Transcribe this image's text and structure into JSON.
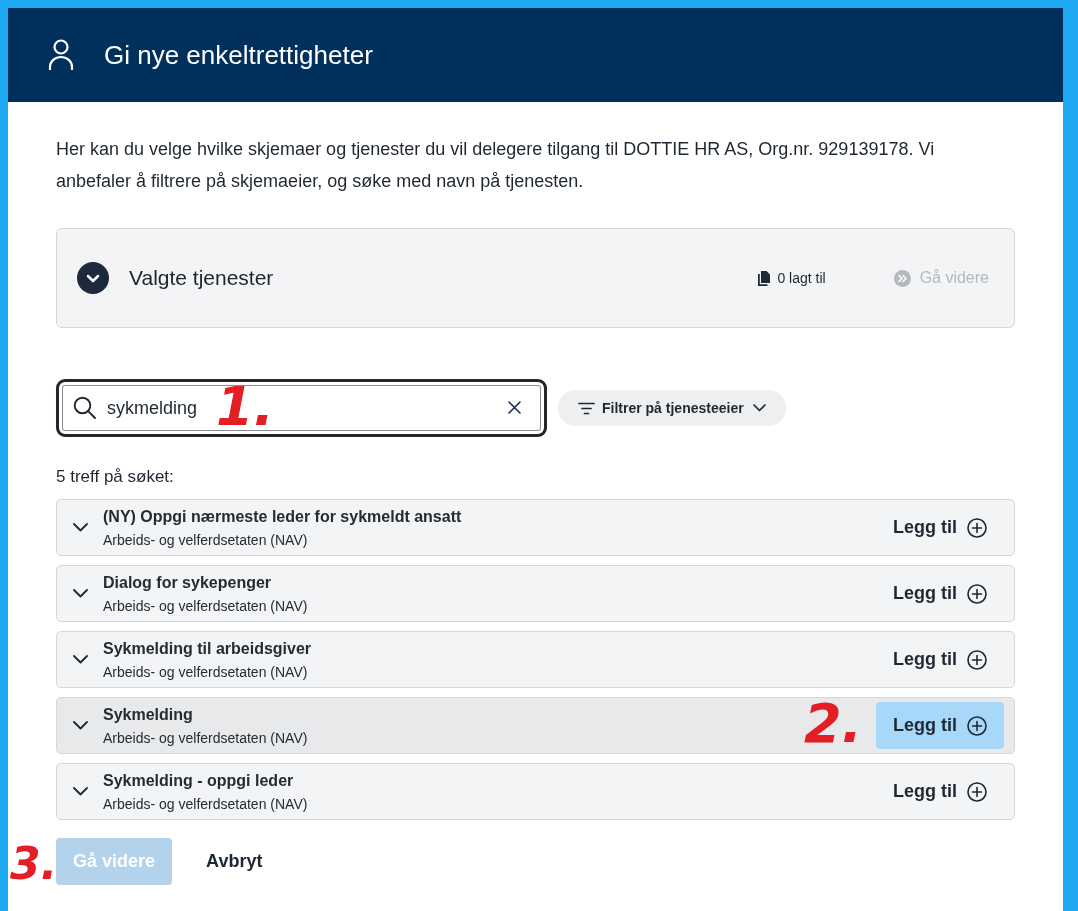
{
  "header": {
    "title": "Gi nye enkeltrettigheter"
  },
  "intro": "Her kan du velge hvilke skjemaer og tjenester du vil delegere tilgang til DOTTIE HR AS, Org.nr. 929139178. Vi anbefaler å filtrere på skjemaeier, og søke med navn på tjenesten.",
  "selected_panel": {
    "title": "Valgte tjenester",
    "expanded": false,
    "count": "0 lagt til",
    "next_button": {
      "label": "Gå videre",
      "disabled": true
    }
  },
  "search": {
    "value": "sykmelding",
    "annotation": "1."
  },
  "filter": {
    "label": "Filtrer på tjenesteeier"
  },
  "result_count": "5 treff på søket:",
  "results": [
    {
      "title": "(NY) Oppgi nærmeste leder for sykmeldt ansatt",
      "owner": "Arbeids- og velferdsetaten (NAV)",
      "add_label": "Legg til",
      "highlighted": false
    },
    {
      "title": "Dialog for sykepenger",
      "owner": "Arbeids- og velferdsetaten (NAV)",
      "add_label": "Legg til",
      "highlighted": false
    },
    {
      "title": "Sykmelding til arbeidsgiver",
      "owner": "Arbeids- og velferdsetaten (NAV)",
      "add_label": "Legg til",
      "highlighted": false
    },
    {
      "title": "Sykmelding",
      "owner": "Arbeids- og velferdsetaten (NAV)",
      "add_label": "Legg til",
      "highlighted": true,
      "annotation": "2."
    },
    {
      "title": "Sykmelding - oppgi leder",
      "owner": "Arbeids- og velferdsetaten (NAV)",
      "add_label": "Legg til",
      "highlighted": false
    }
  ],
  "footer": {
    "next_button": {
      "label": "Gå videre",
      "disabled": true
    },
    "cancel_button": {
      "label": "Avbryt"
    },
    "annotation": "3."
  }
}
